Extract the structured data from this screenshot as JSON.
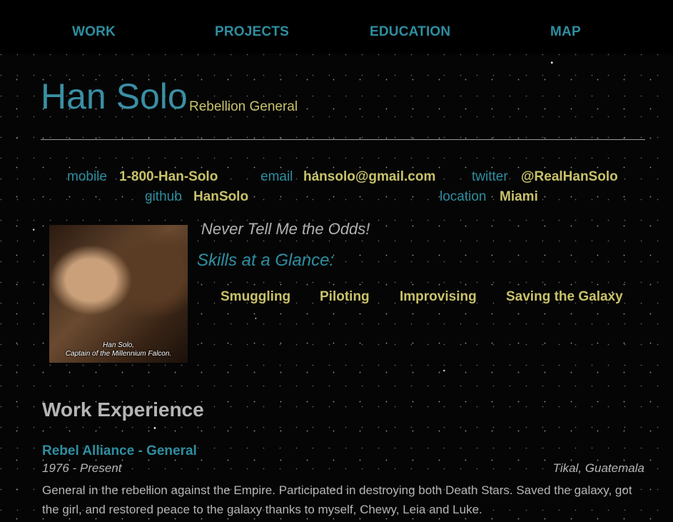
{
  "nav": {
    "items": [
      {
        "label": "WORK"
      },
      {
        "label": "PROJECTS"
      },
      {
        "label": "EDUCATION"
      },
      {
        "label": "MAP"
      }
    ]
  },
  "header": {
    "name": "Han Solo",
    "role": "Rebellion General"
  },
  "contacts": {
    "mobile": {
      "label": "mobile",
      "value": "1-800-Han-Solo"
    },
    "email": {
      "label": "email",
      "value": "hansolo@gmail.com"
    },
    "twitter": {
      "label": "twitter",
      "value": "@RealHanSolo"
    },
    "github": {
      "label": "github",
      "value": "HanSolo"
    },
    "location": {
      "label": "location",
      "value": "Miami"
    }
  },
  "bio_pic": {
    "caption_line1": "Han Solo,",
    "caption_line2": "Captain of the Millennium Falcon."
  },
  "welcome_message": "Never Tell Me the Odds!",
  "skills": {
    "title": "Skills at a Glance:",
    "items": [
      "Smuggling",
      "Piloting",
      "Improvising",
      "Saving the Galaxy"
    ]
  },
  "work": {
    "section_title": "Work Experience",
    "jobs": [
      {
        "title": "Rebel Alliance - General",
        "dates": "1976 - Present",
        "location": "Tikal, Guatemala",
        "description": "General in the rebellion against the Empire. Participated in destroying both Death Stars. Saved the galaxy, got the girl, and restored peace to the galaxy thanks to myself, Chewy, Leia and Luke."
      }
    ]
  },
  "colors": {
    "accent": "#2e8ea0",
    "highlight": "#c9c26a",
    "text": "#b5b5b5",
    "background": "#050505"
  }
}
